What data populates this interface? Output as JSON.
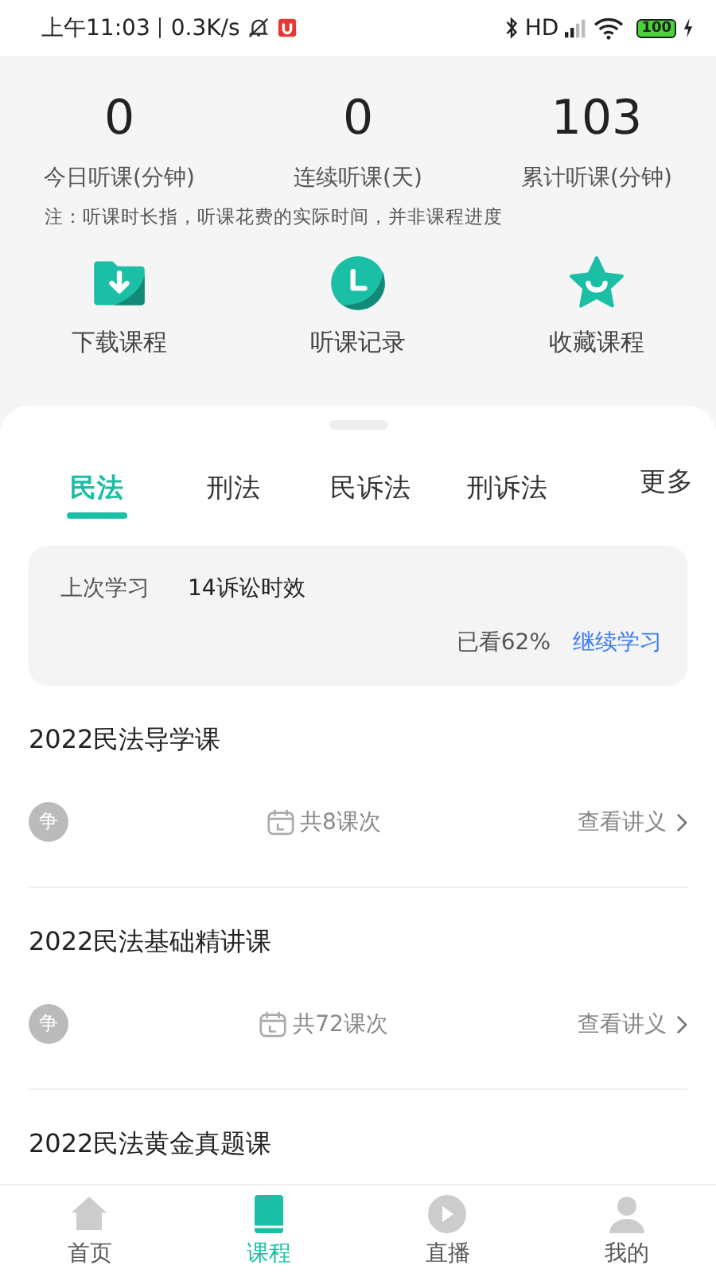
{
  "status_bar": {
    "time": "上午11:03",
    "speed": "0.3K/s",
    "signal_label": "HD",
    "battery": "100"
  },
  "stats": [
    {
      "value": "0",
      "label": "今日听课(分钟)"
    },
    {
      "value": "0",
      "label": "连续听课(天)"
    },
    {
      "value": "103",
      "label": "累计听课(分钟)"
    }
  ],
  "note": "注：听课时长指，听课花费的实际时间，并非课程进度",
  "shortcuts": [
    {
      "kind": "download",
      "label": "下载课程"
    },
    {
      "kind": "history",
      "label": "听课记录"
    },
    {
      "kind": "favorite",
      "label": "收藏课程"
    }
  ],
  "tabs": [
    {
      "label": "民法",
      "selected": true
    },
    {
      "label": "刑法",
      "selected": false
    },
    {
      "label": "民诉法",
      "selected": false
    },
    {
      "label": "刑诉法",
      "selected": false
    }
  ],
  "more_tab": "更多",
  "resume": {
    "label": "上次学习",
    "lesson": "14诉讼时效",
    "progress": "已看62%",
    "action": "继续学习"
  },
  "courses": [
    {
      "title": "2022民法导学课",
      "badge": "争",
      "count": "共8课次",
      "link": "查看讲义"
    },
    {
      "title": "2022民法基础精讲课",
      "badge": "争",
      "count": "共72课次",
      "link": "查看讲义"
    },
    {
      "title": "2022民法黄金真题课"
    }
  ],
  "nav": [
    {
      "kind": "home",
      "label": "首页",
      "selected": false
    },
    {
      "kind": "book",
      "label": "课程",
      "selected": true
    },
    {
      "kind": "play",
      "label": "直播",
      "selected": false
    },
    {
      "kind": "person",
      "label": "我的",
      "selected": false
    }
  ]
}
